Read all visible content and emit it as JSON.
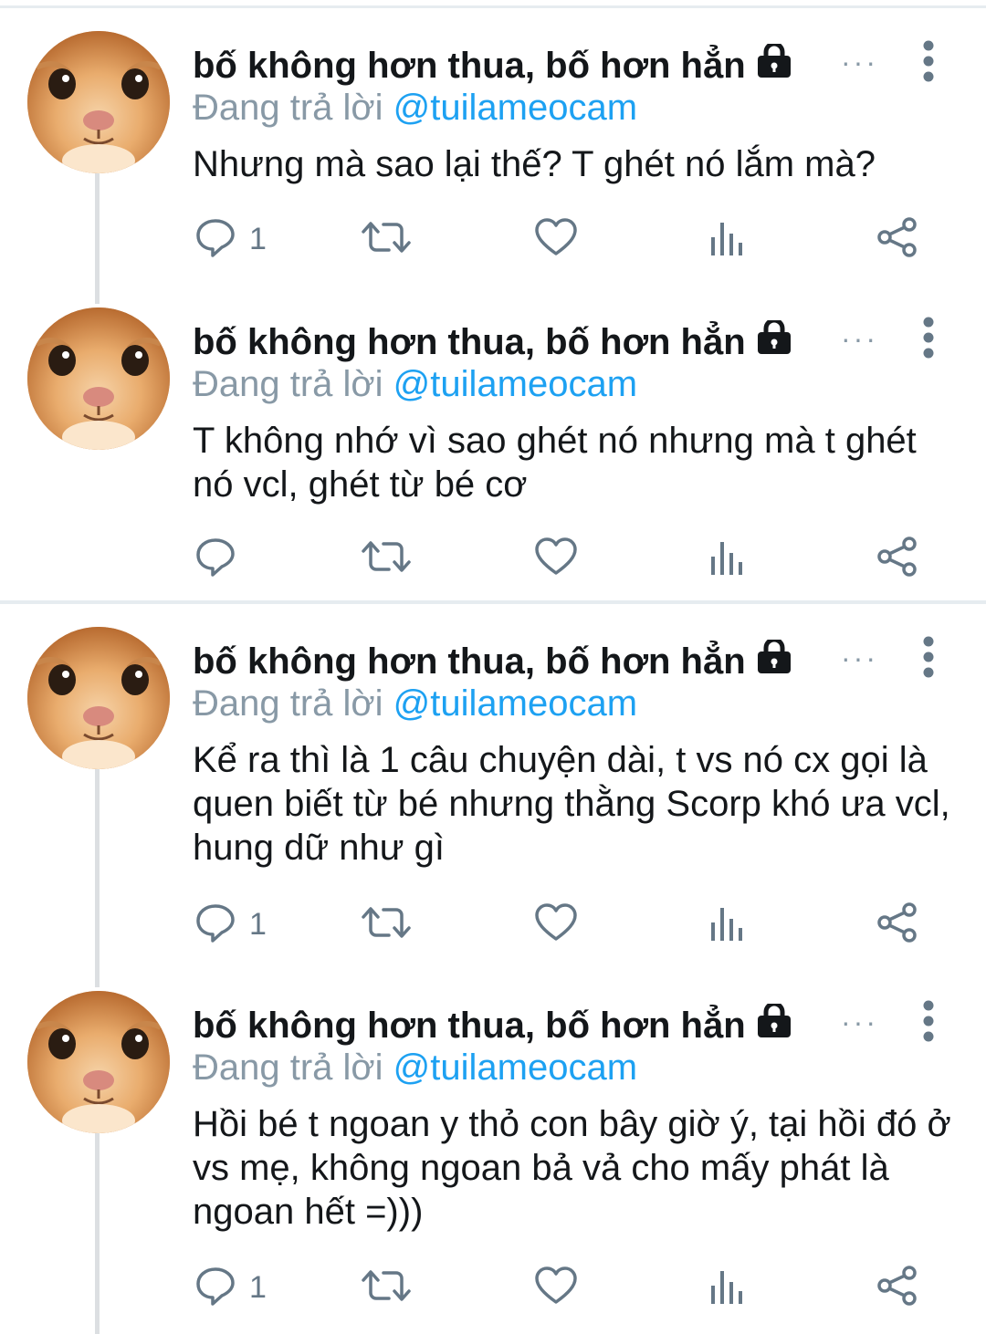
{
  "tweets": [
    {
      "author": "bố không hơn thua, bố hơn hẳn",
      "reply_prefix": "Đang trả lời",
      "reply_handle": "@tuilameocam",
      "text": "Nhưng mà sao lại thế? T ghét nó lắm mà?",
      "reply_count": "1",
      "ellipsis": "···"
    },
    {
      "author": "bố không hơn thua, bố hơn hẳn",
      "reply_prefix": "Đang trả lời",
      "reply_handle": "@tuilameocam",
      "text": "T không nhớ vì sao ghét nó nhưng mà t ghét nó vcl, ghét từ bé cơ",
      "reply_count": "",
      "ellipsis": "···"
    },
    {
      "author": "bố không hơn thua, bố hơn hẳn",
      "reply_prefix": "Đang trả lời",
      "reply_handle": "@tuilameocam",
      "text": "Kể ra thì là 1 câu chuyện dài, t vs nó cx gọi là quen biết từ bé nhưng thằng Scorp khó ưa vcl, hung dữ như gì",
      "reply_count": "1",
      "ellipsis": "···"
    },
    {
      "author": "bố không hơn thua, bố hơn hẳn",
      "reply_prefix": "Đang trả lời",
      "reply_handle": "@tuilameocam",
      "text": "Hồi bé t ngoan y thỏ con bây giờ ý, tại hồi đó ở vs mẹ, không ngoan bả vả cho mấy phát là ngoan hết =)))",
      "reply_count": "1",
      "ellipsis": "···"
    }
  ],
  "colors": {
    "text": "#14171a",
    "muted": "#8899a6",
    "link": "#1da1f2",
    "icon": "#657786",
    "divider": "#e6ecf0",
    "thread_line": "#dcdfe2"
  },
  "icons": [
    "lock-icon",
    "more-vertical-icon",
    "reply-icon",
    "retweet-icon",
    "like-icon",
    "analytics-icon",
    "share-icon"
  ]
}
